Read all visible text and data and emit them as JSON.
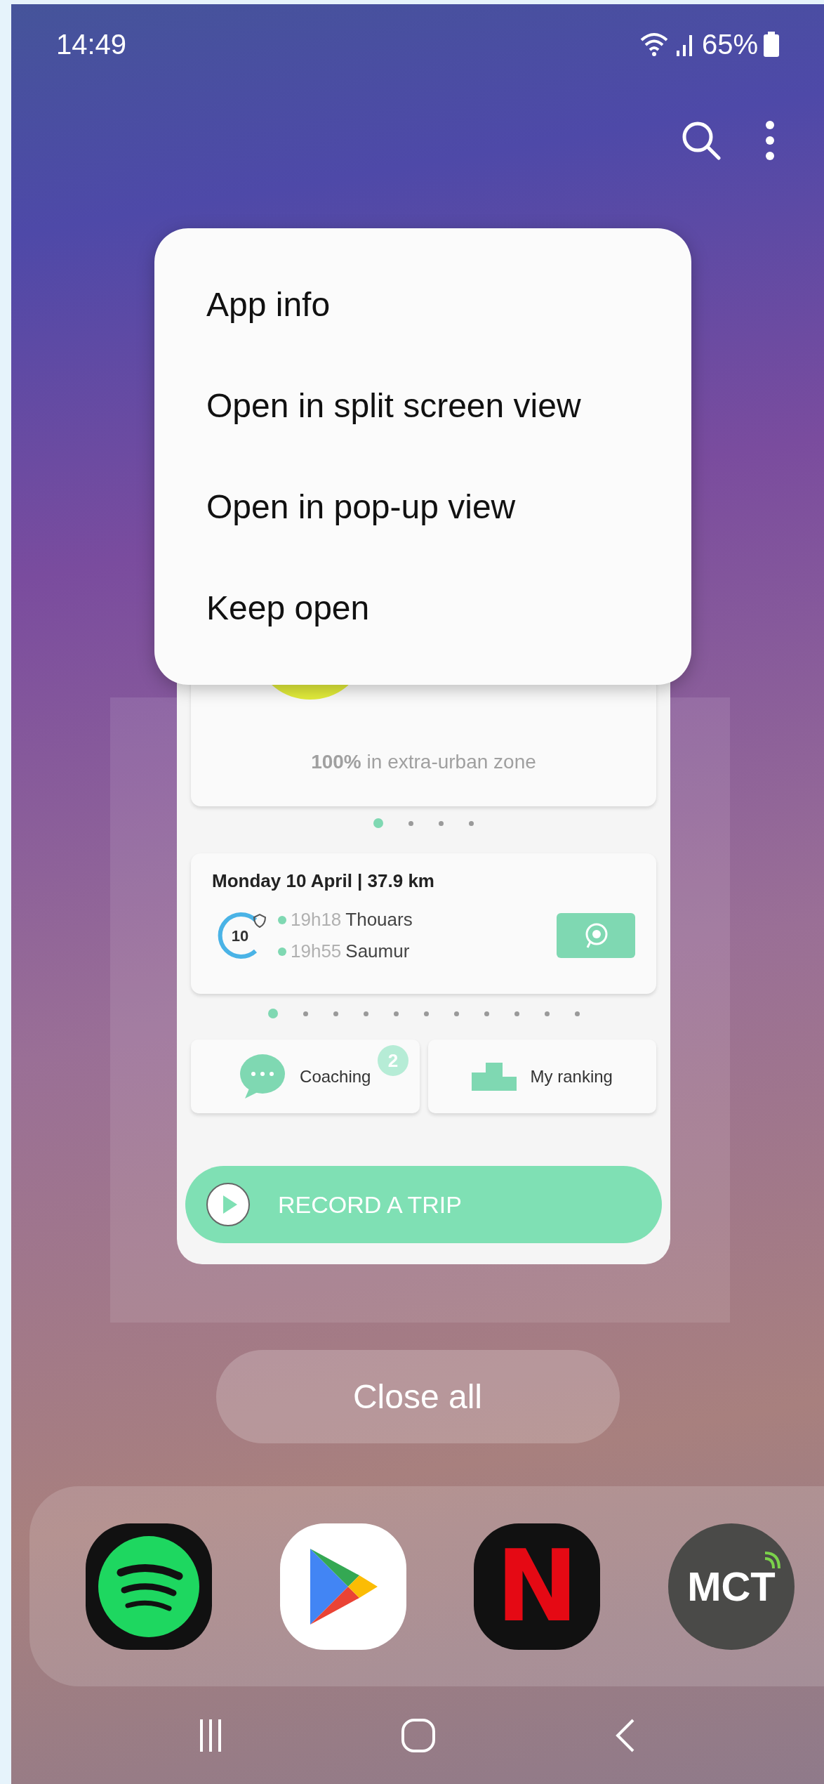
{
  "status_bar": {
    "time": "14:49",
    "battery": "65%"
  },
  "menu": {
    "items": [
      "App info",
      "Open in split screen view",
      "Open in pop-up view",
      "Keep open"
    ]
  },
  "app_preview": {
    "zone_summary": "**100%** in extra-urban zone",
    "pager_top": [
      {
        "selected": true
      },
      {
        "selected": false
      },
      {
        "selected": false
      },
      {
        "selected": false
      }
    ],
    "trip": {
      "title": "Monday 10 April | 37.9 km",
      "score": "10",
      "stops": [
        {
          "time": "19h18",
          "place": "Thouars"
        },
        {
          "time": "19h55",
          "place": "Saumur"
        }
      ]
    },
    "pager_trips": [
      {
        "selected": true
      },
      {
        "selected": false
      },
      {
        "selected": false
      },
      {
        "selected": false
      },
      {
        "selected": false
      },
      {
        "selected": false
      },
      {
        "selected": false
      },
      {
        "selected": false
      },
      {
        "selected": false
      },
      {
        "selected": false
      },
      {
        "selected": false
      }
    ],
    "shortcuts": [
      {
        "kind": "coaching",
        "label": "Coaching",
        "badge": "2"
      },
      {
        "kind": "ranking",
        "label": "My ranking"
      }
    ],
    "record_button": "RECORD A TRIP"
  },
  "close_all": "Close all",
  "dock": [
    {
      "kind": "music"
    },
    {
      "kind": "store"
    },
    {
      "kind": "letter",
      "text": "N"
    },
    {
      "kind": "badge",
      "text": "MCT"
    }
  ]
}
